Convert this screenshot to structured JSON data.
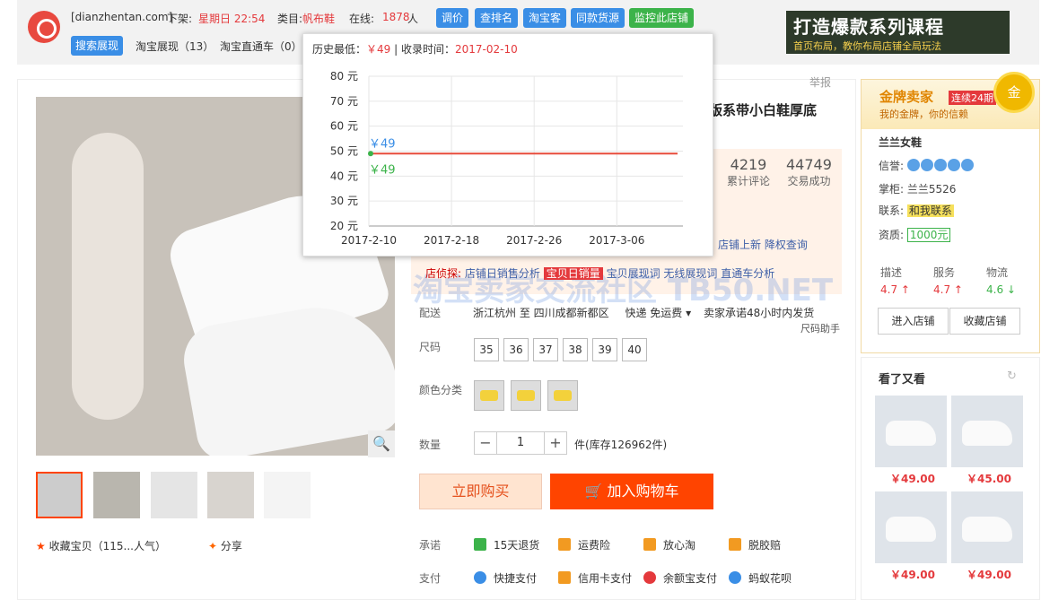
{
  "topbar": {
    "site": "[dianzhentan.com]",
    "offshelf_label": "下架:",
    "offshelf_value": "星期日 22:54",
    "category_label": "类目:",
    "category_value": "帆布鞋",
    "online_label": "在线:",
    "online_value": "1878",
    "online_unit": "人",
    "buttons": [
      "调价",
      "查排名",
      "淘宝客",
      "同款货源",
      "监控此店铺"
    ],
    "tabs": [
      "搜索展现",
      "淘宝展现（13）",
      "淘宝直通车（0）"
    ],
    "banner_line1": "打造爆款系列课程",
    "banner_line2": "首页布局，教你布局店铺全局玩法"
  },
  "popup": {
    "low_label": "历史最低：",
    "low_value": "￥49",
    "sep": "|",
    "date_label": "收录时间：",
    "date_value": "2017-02-10"
  },
  "chart_data": {
    "type": "line",
    "x": [
      "2017-02-10"
    ],
    "xticks": [
      "2017-2-10",
      "2017-2-18",
      "2017-2-26",
      "2017-3-06"
    ],
    "yticks": [
      "20 元",
      "30 元",
      "40 元",
      "50 元",
      "60 元",
      "70 元",
      "80 元"
    ],
    "ylim": [
      20,
      80
    ],
    "series": [
      {
        "values": [
          49
        ],
        "color": "#e74c3c"
      }
    ],
    "annotations": [
      "￥49",
      "￥49"
    ],
    "grid": true
  },
  "product": {
    "title_fragment": "版系带小白鞋厚底",
    "report": "举报",
    "reviews": "4219",
    "reviews_label": "累计评论",
    "deals": "44749",
    "deals_label": "交易成功",
    "links_row": "店铺上新  降权查询",
    "tool_label": "店侦探:",
    "tools": [
      "店铺日销售分析",
      "宝贝日销量",
      "宝贝展现词",
      "无线展现词",
      "直通车分析"
    ],
    "watermark": "淘宝卖家交流社区  TB50.NET",
    "shipping_label": "配送",
    "shipping_route": "浙江杭州 至  四川成都新都区",
    "shipping_fee": "快递 免运费",
    "shipping_promise": "卖家承诺48小时内发货",
    "size_help": "尺码助手",
    "size_label": "尺码",
    "sizes": [
      "35",
      "36",
      "37",
      "38",
      "39",
      "40"
    ],
    "color_label": "颜色分类",
    "qty_label": "数量",
    "qty_value": "1",
    "minus": "−",
    "plus": "+",
    "stock": "件(库存126962件)",
    "buy_now": "立即购买",
    "add_cart": "🛒 加入购物车",
    "promise_label": "承诺",
    "promises": [
      "15天退货",
      "运费险",
      "放心淘",
      "脱胶赔"
    ],
    "pay_label": "支付",
    "pays": [
      "快捷支付",
      "信用卡支付",
      "余额宝支付",
      "蚂蚁花呗"
    ],
    "favorite": "收藏宝贝（115...人气）",
    "share": "分享",
    "zoom_icon": "🔍"
  },
  "seller": {
    "gold_title": "金牌卖家",
    "gold_badge": "连续24期",
    "gold_sub": "我的金牌，你的信赖",
    "medal": "金",
    "shop": "兰兰女鞋",
    "credit_label": "信誉:",
    "keeper_label": "掌柜:",
    "keeper": "兰兰5526",
    "contact_label": "联系:",
    "contact": "和我联系",
    "qual_label": "资质:",
    "deposit": "1000元",
    "scores": [
      {
        "label": "描述",
        "value": "4.7 ↑"
      },
      {
        "label": "服务",
        "value": "4.7 ↑"
      },
      {
        "label": "物流",
        "value": "4.6 ↓"
      }
    ],
    "enter": "进入店铺",
    "collect": "收藏店铺"
  },
  "also": {
    "title": "看了又看",
    "refresh_icon": "↻",
    "prices": [
      "￥49.00",
      "￥45.00",
      "￥49.00",
      "￥49.00"
    ]
  }
}
